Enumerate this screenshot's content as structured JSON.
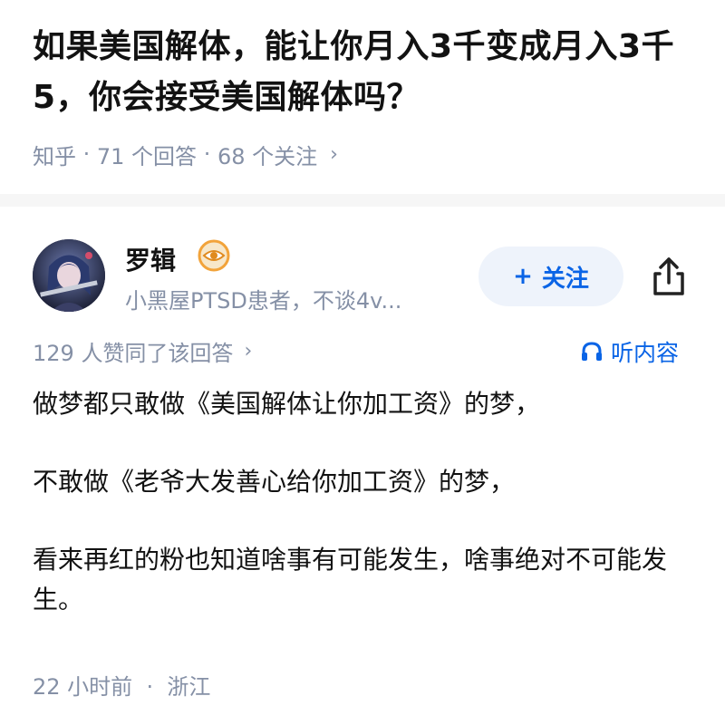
{
  "question": {
    "title": "如果美国解体，能让你月入3千变成月入3千5，你会接受美国解体吗？",
    "source": "知乎",
    "answers_count": "71 个回答",
    "followers_count": "68 个关注",
    "meta_chevron": "›"
  },
  "author": {
    "name": "罗辑",
    "bio": "小黑屋PTSD患者，不谈4v...",
    "badge_icon": "eye-badge-icon",
    "follow_label": "关注",
    "follow_plus": "+"
  },
  "answer": {
    "likes_text": "129 人赞同了该回答",
    "likes_chevron": "›",
    "listen_label": "听内容",
    "paragraphs": [
      "做梦都只敢做《美国解体让你加工资》的梦，",
      "不敢做《老爷大发善心给你加工资》的梦，",
      "看来再红的粉也知道啥事有可能发生，啥事绝对不可能发生。"
    ],
    "time": "22 小时前",
    "location": "浙江"
  },
  "colors": {
    "accent": "#0a64e6",
    "meta": "#8590a6",
    "follow_bg": "#eef3fb",
    "badge": "#f2a33a"
  }
}
